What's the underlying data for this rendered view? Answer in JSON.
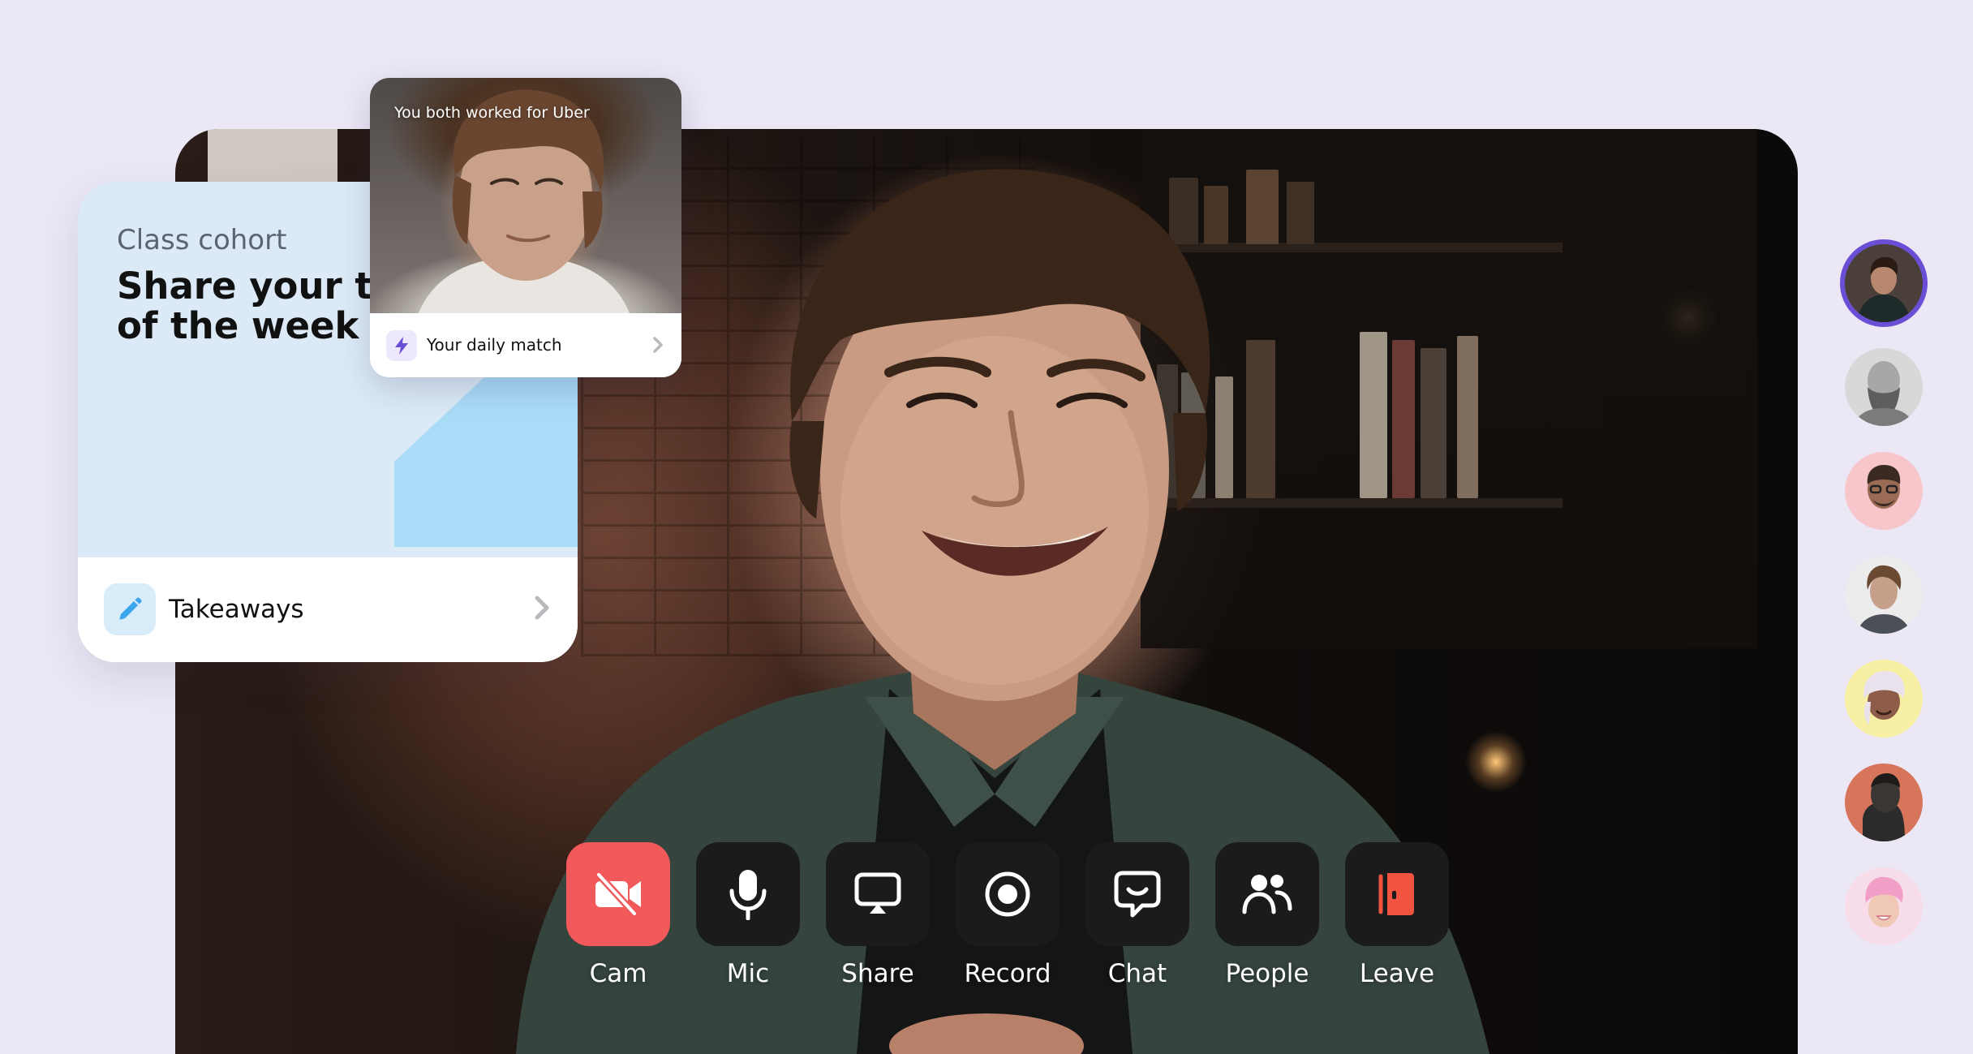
{
  "cohort_card": {
    "eyebrow": "Class cohort",
    "title": "Share your takeaways\nof the week",
    "action_label": "Takeaways",
    "action_icon": "pencil-icon",
    "accent_color": "#abdcf7"
  },
  "match_card": {
    "caption": "You both worked for Uber",
    "action_label": "Your daily match",
    "action_icon": "lightning-icon"
  },
  "toolbar": {
    "cam_label": "Cam",
    "mic_label": "Mic",
    "share_label": "Share",
    "record_label": "Record",
    "chat_label": "Chat",
    "people_label": "People",
    "leave_label": "Leave",
    "cam_off_color": "#f2595a",
    "leave_color": "#f0533f"
  },
  "participants": [
    {
      "icon": "avatar-man-dark-shirt",
      "active": true
    },
    {
      "icon": "avatar-bald-beard-grayscale",
      "active": false
    },
    {
      "icon": "avatar-glasses-pink",
      "active": false
    },
    {
      "icon": "avatar-curly-hair",
      "active": false
    },
    {
      "icon": "avatar-memoji-yellow",
      "active": false
    },
    {
      "icon": "avatar-dark-portrait",
      "active": false
    },
    {
      "icon": "avatar-memoji-pink-hair",
      "active": false
    }
  ]
}
